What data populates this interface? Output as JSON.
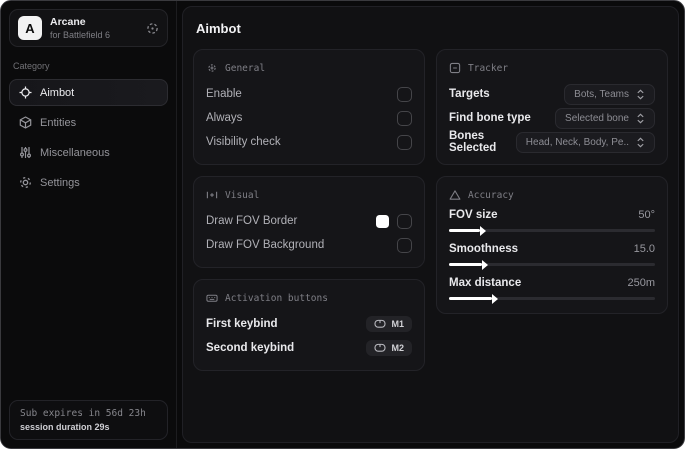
{
  "app": {
    "name": "Arcane",
    "subtitle": "for Battlefield 6",
    "logo_letter": "A"
  },
  "sidebar": {
    "category_label": "Category",
    "items": [
      {
        "label": "Aimbot",
        "icon": "crosshair-icon",
        "selected": true
      },
      {
        "label": "Entities",
        "icon": "cube-icon",
        "selected": false
      },
      {
        "label": "Miscellaneous",
        "icon": "mixer-icon",
        "selected": false
      },
      {
        "label": "Settings",
        "icon": "gear-icon",
        "selected": false
      }
    ],
    "subscription": {
      "line1": "Sub expires in 56d 23h",
      "line2": "session duration 29s"
    }
  },
  "page": {
    "title": "Aimbot"
  },
  "sections": {
    "general": {
      "title": "General",
      "rows": [
        {
          "label": "Enable",
          "checked": false
        },
        {
          "label": "Always",
          "checked": false
        },
        {
          "label": "Visibility check",
          "checked": false
        }
      ]
    },
    "visual": {
      "title": "Visual",
      "rows": [
        {
          "label": "Draw FOV Border",
          "swatch_color": "#ffffff",
          "checked": false
        },
        {
          "label": "Draw FOV Background",
          "checked": false
        }
      ]
    },
    "activation": {
      "title": "Activation buttons",
      "rows": [
        {
          "label": "First keybind",
          "key": "M1"
        },
        {
          "label": "Second keybind",
          "key": "M2"
        }
      ]
    },
    "tracker": {
      "title": "Tracker",
      "rows": [
        {
          "label": "Targets",
          "value": "Bots, Teams"
        },
        {
          "label": "Find bone type",
          "value": "Selected bone"
        },
        {
          "label": "Bones Selected",
          "value": "Head, Neck, Body, Pe.."
        }
      ]
    },
    "accuracy": {
      "title": "Accuracy",
      "rows": [
        {
          "label": "FOV size",
          "value": "50°",
          "fill_pct": 15
        },
        {
          "label": "Smoothness",
          "value": "15.0",
          "fill_pct": 16
        },
        {
          "label": "Max distance",
          "value": "250m",
          "fill_pct": 21
        }
      ]
    }
  },
  "colors": {
    "background": "#0a0a0b",
    "card": "#151518",
    "accent": "#ffffff",
    "text_primary": "#ececef",
    "text_muted": "#8d8d94",
    "fov_border_swatch": "#ffffff"
  }
}
